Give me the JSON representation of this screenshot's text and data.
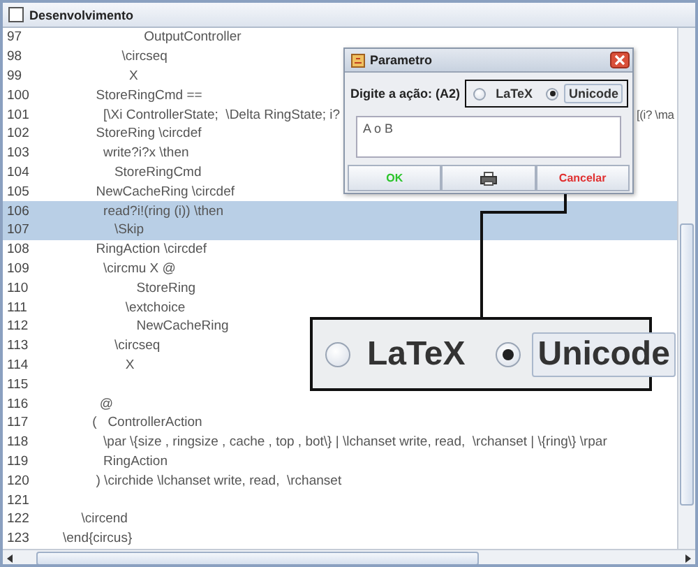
{
  "window": {
    "title": "Desenvolvimento"
  },
  "editor": {
    "lines": [
      {
        "number": "97",
        "text": "                      OutputController",
        "selected": false
      },
      {
        "number": "98",
        "text": "                \\circseq",
        "selected": false
      },
      {
        "number": "99",
        "text": "                  X",
        "selected": false
      },
      {
        "number": "100",
        "text": "         StoreRingCmd ==",
        "selected": false
      },
      {
        "number": "101",
        "text": "           [\\Xi ControllerState;  \\Delta RingState; i?",
        "tail": "[(i? \\ma",
        "selected": false
      },
      {
        "number": "102",
        "text": "         StoreRing \\circdef",
        "selected": false
      },
      {
        "number": "103",
        "text": "           write?i?x \\then",
        "selected": false
      },
      {
        "number": "104",
        "text": "              StoreRingCmd",
        "selected": false
      },
      {
        "number": "105",
        "text": "         NewCacheRing \\circdef",
        "selected": false
      },
      {
        "number": "106",
        "text": "           read?i!(ring (i)) \\then",
        "selected": true
      },
      {
        "number": "107",
        "text": "              \\Skip",
        "selected": true
      },
      {
        "number": "108",
        "text": "         RingAction \\circdef",
        "selected": false
      },
      {
        "number": "109",
        "text": "           \\circmu X @",
        "selected": false
      },
      {
        "number": "110",
        "text": "                    StoreRing",
        "selected": false
      },
      {
        "number": "111",
        "text": "                 \\extchoice",
        "selected": false
      },
      {
        "number": "112",
        "text": "                    NewCacheRing",
        "selected": false
      },
      {
        "number": "113",
        "text": "              \\circseq",
        "selected": false
      },
      {
        "number": "114",
        "text": "                 X",
        "selected": false
      },
      {
        "number": "115",
        "selected": false
      },
      {
        "number": "116",
        "text": "          @",
        "selected": false
      },
      {
        "number": "117",
        "text": "        (   ControllerAction",
        "selected": false
      },
      {
        "number": "118",
        "text": "           \\par \\{size , ringsize , cache , top , bot\\} | \\lchanset write, read,  \\rchanset | \\{ring\\} \\rpar",
        "selected": false
      },
      {
        "number": "119",
        "text": "           RingAction",
        "selected": false
      },
      {
        "number": "120",
        "text": "         ) \\circhide \\lchanset write, read,  \\rchanset",
        "selected": false
      },
      {
        "number": "121",
        "selected": false
      },
      {
        "number": "122",
        "text": "     \\circend",
        "selected": false
      },
      {
        "number": "123",
        "text": "\\end{circus}",
        "selected": false
      }
    ]
  },
  "dialog": {
    "title": "Parametro",
    "prompt": "Digite a ação: (A2)",
    "options": [
      {
        "label": "LaTeX",
        "selected": false
      },
      {
        "label": "Unicode",
        "selected": true
      }
    ],
    "value": "A o B",
    "buttons": [
      {
        "kind": "ok",
        "label": "OK"
      },
      {
        "kind": "print"
      },
      {
        "kind": "cancel",
        "label": "Cancelar"
      }
    ]
  },
  "callout": {
    "options": [
      {
        "label": "LaTeX",
        "selected": false
      },
      {
        "label": "Unicode",
        "selected": true
      }
    ]
  }
}
